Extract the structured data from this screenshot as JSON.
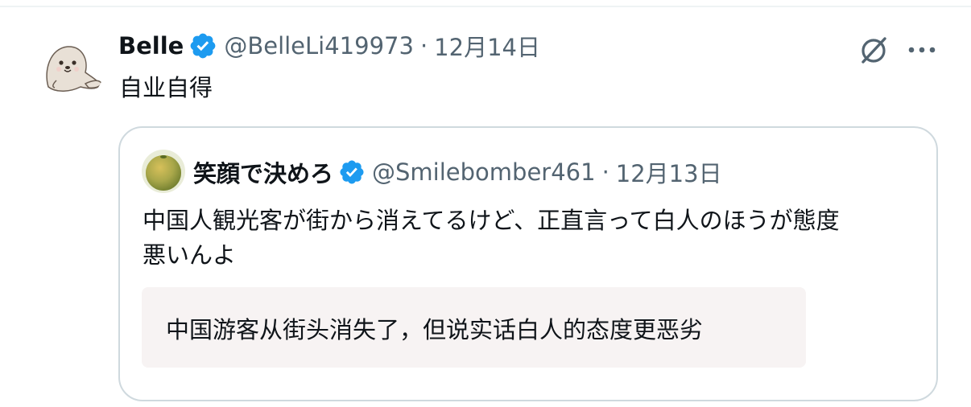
{
  "tweet": {
    "author": {
      "display_name": "Belle",
      "handle": "@BelleLi419973",
      "avatar_icon": "seal-avatar-icon"
    },
    "separator": "·",
    "date": "12月14日",
    "text": "自业自得",
    "verified_icon": "verified-badge-icon",
    "actions": {
      "grok_icon": "grok-icon",
      "more_icon": "more-options-icon"
    }
  },
  "quote": {
    "author": {
      "display_name": "笑顔で決めろ",
      "handle": "@Smilebomber461",
      "avatar_icon": "orange-fruit-avatar-icon"
    },
    "separator": "·",
    "date": "12月13日",
    "text_line1": "中国人観光客が街から消えてるけど、正直言って白人のほうが態度",
    "text_line2": "悪いんよ",
    "translation": "中国游客从街头消失了，但说实话白人的态度更恶劣"
  },
  "colors": {
    "verified_blue": "#1d9bf0",
    "secondary_text": "#536471",
    "border": "#cfd9de",
    "translation_bg": "#f7f3f3"
  }
}
